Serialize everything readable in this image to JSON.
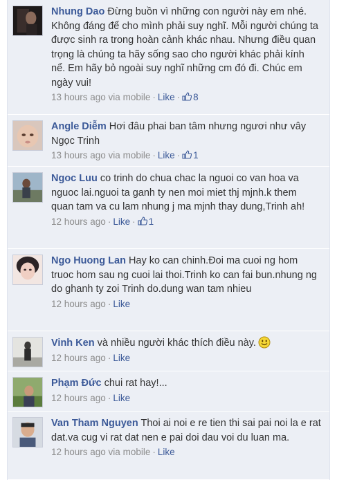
{
  "comments": [
    {
      "author": "Nhung Dao",
      "text": " Đừng buồn vì những con người này em nhé. Không đáng để cho mình phải suy nghĩ. Mỗi người chúng ta được sinh ra trong hoàn cảnh khác nhau. Nhưng điều quan trọng là chúng ta hãy sống sao cho người khác phải kính nể. Em hãy bỏ ngoài suy nghĩ những cm đó đi. Chúc em ngày vui!",
      "time": "13 hours ago via mobile",
      "like": "Like",
      "likes": "8"
    },
    {
      "author": "Angle Diễm",
      "text": " Hơi đâu phai ban tâm nhưng ngươi như vây Ngọc Trinh",
      "time": "13 hours ago via mobile",
      "like": "Like",
      "likes": "1"
    },
    {
      "author": "Ngoc Luu",
      "text": " co trinh do chua chac la nguoi co van hoa va nguoc lai.nguoi ta ganh ty nen moi miet thj mjnh.k them quan tam va cu lam nhung j ma mjnh thay dung,Trinh ah!",
      "time": "12 hours ago",
      "like": "Like",
      "likes": "1"
    },
    {
      "author": "Ngo Huong Lan",
      "text": " Hay ko can chinh.Đoi ma cuoi ng hom truoc hom sau ng cuoi lai thoi.Trinh ko can fai bun.nhung ng do ghanh ty zoi Trinh do.dung wan tam nhieu",
      "time": "12 hours ago",
      "like": "Like"
    },
    {
      "author": "Vinh Ken",
      "text": " và nhiều người khác thích điều này.",
      "time": "12 hours ago",
      "like": "Like"
    },
    {
      "author": "Phạm Đức",
      "text": " chui rat hay!...",
      "time": "12 hours ago",
      "like": "Like"
    },
    {
      "author": "Van Tham Nguyen",
      "text": " Thoi ai noi e re tien thi sai pai noi la e rat dat.va cug vi rat dat nen e pai doi dau voi du luan ma.",
      "time": "12 hours ago via mobile",
      "like": "Like"
    }
  ],
  "colors": {
    "link": "#3b5998",
    "comment_bg": "#eceff5",
    "meta": "#8c8c8c",
    "text": "#333333"
  },
  "icons": {
    "likes": "thumbs-up-icon",
    "emoticon": "smiley-icon"
  }
}
